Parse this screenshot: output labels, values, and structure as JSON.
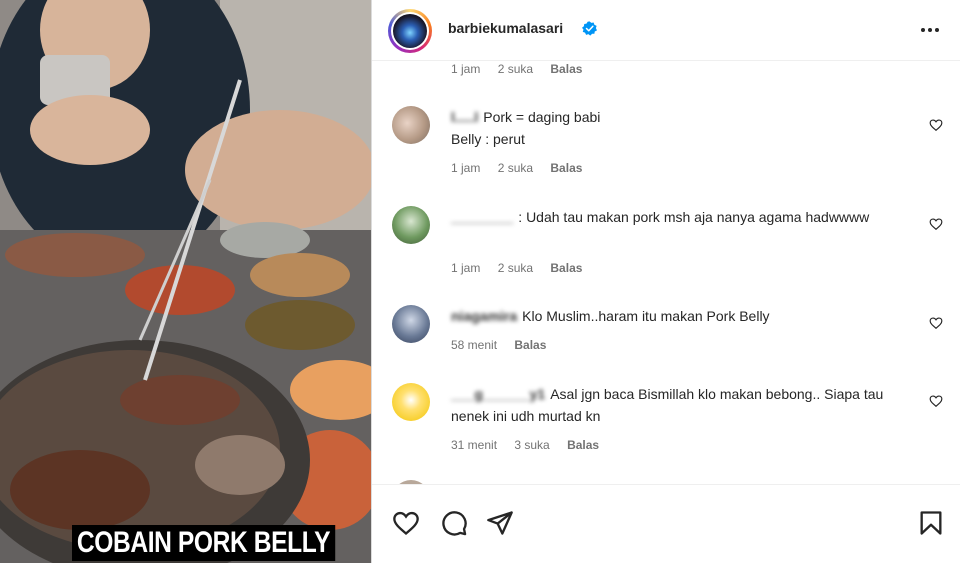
{
  "media": {
    "caption": "COBAIN PORK BELLY"
  },
  "header": {
    "username": "barbiekumalasari",
    "verified_icon": "verified-badge-icon",
    "more_icon": "more-options-icon"
  },
  "comments": [
    {
      "name": "",
      "text": "",
      "time": "1 jam",
      "likes": "2 suka",
      "reply": "Balas"
    },
    {
      "name": "l.....l",
      "text": "Pork = daging babi\nBelly : perut",
      "time": "1 jam",
      "likes": "2 suka",
      "reply": "Balas"
    },
    {
      "name": "________",
      "text": ": Udah tau makan pork msh aja nanya agama hadwwww",
      "time": "1 jam",
      "likes": "2 suka",
      "reply": "Balas"
    },
    {
      "name": "niagamira",
      "text": "Klo Muslim..haram itu makan Pork Belly",
      "time": "58 menit",
      "likes": "",
      "reply": "Balas"
    },
    {
      "name": "___g______y1",
      "text": "Asal jgn baca Bismillah klo makan bebong.. Siapa tau nenek ini udh murtad kn",
      "time": "31 menit",
      "likes": "3 suka",
      "reply": "Balas"
    }
  ],
  "actions": {
    "like": "heart-icon",
    "comment": "comment-icon",
    "share": "share-icon",
    "save": "bookmark-icon"
  },
  "colors": {
    "link_blue": "#0095f6",
    "meta_gray": "#737373",
    "text": "#262626"
  }
}
